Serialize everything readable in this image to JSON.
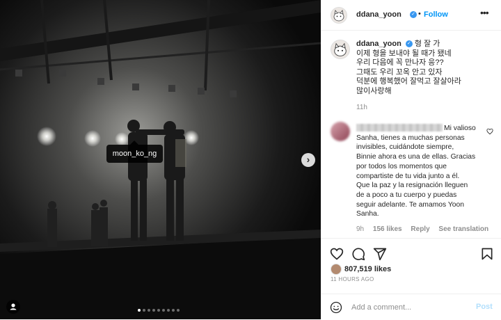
{
  "colors": {
    "accent": "#0095f6",
    "muted": "#8e8e8e",
    "text": "#262626",
    "disabled_post": "#b2dffc"
  },
  "media": {
    "tag_label": "moon_ko_ng",
    "slide_count": 9,
    "active_slide": 1
  },
  "header": {
    "username": "ddana_yoon",
    "separator": "•",
    "follow_label": "Follow",
    "more_label": "•••"
  },
  "caption": {
    "username": "ddana_yoon",
    "lines": [
      "형 잘 가",
      "이제 형을 보내야 될 때가 됐네",
      "우리 다음에 꼭 만나자 응??",
      "그때도 우리 꼬옥 안고 있자",
      "덕분에 행복했어 잘먹고 잘살아라",
      "많이사랑해"
    ],
    "time": "11h"
  },
  "comment": {
    "lines": [
      "Mi valioso",
      "Sanha, tienes a muchas personas",
      "invisibles, cuidándote siempre,",
      "Binnie ahora es una de ellas. Gracias",
      "por todos los momentos que",
      "compartiste de tu vida junto a él.",
      "Que la paz y la resignación lleguen",
      "de a poco a tu cuerpo y puedas",
      "seguir adelante. Te amamos Yoon",
      "Sanha."
    ],
    "time": "9h",
    "likes": "156 likes",
    "reply": "Reply",
    "translate": "See translation"
  },
  "actions": {
    "likes_count": "807,519 likes",
    "time_ago": "11 HOURS AGO",
    "add_comment_placeholder": "Add a comment...",
    "post_label": "Post"
  },
  "icons": [
    "heart-icon",
    "comment-icon",
    "share-icon",
    "bookmark-icon",
    "emoji-icon",
    "verified-icon",
    "user-tag-icon",
    "chevron-right-icon",
    "more-icon"
  ]
}
